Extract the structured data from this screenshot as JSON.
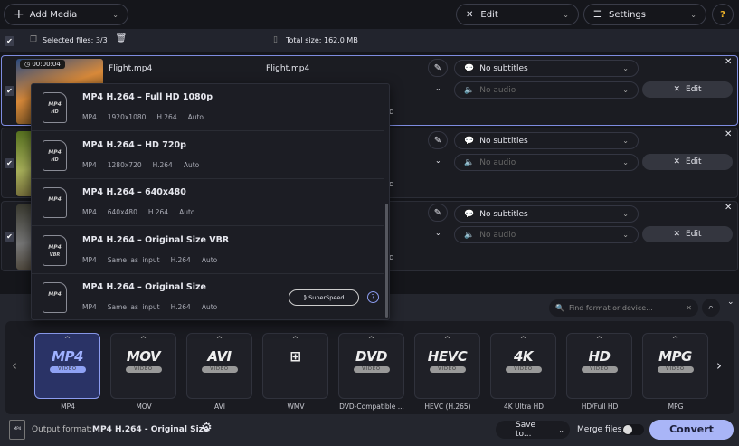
{
  "toolbar": {
    "add_media": "Add Media",
    "edit": "Edit",
    "settings": "Settings",
    "help": "?"
  },
  "selection": {
    "selected_label": "Selected files: 3/3",
    "total_size": "Total size: 162.0 MB"
  },
  "files": [
    {
      "duration": "00:00:04",
      "name": "Flight.mp4",
      "output_name": "Flight.mp4",
      "subtitles": "No subtitles",
      "audio": "No audio",
      "edit": "Edit",
      "selected": true
    },
    {
      "duration": "",
      "name": "",
      "output_name": "",
      "subtitles": "No subtitles",
      "audio": "No audio",
      "edit": "Edit",
      "selected": false
    },
    {
      "duration": "",
      "name": "",
      "output_name": "",
      "subtitles": "No subtitles",
      "audio": "No audio",
      "edit": "Edit",
      "selected": false
    }
  ],
  "row_trailing_text": "d",
  "presets": [
    {
      "icon": "MP4",
      "badge": "HD",
      "title": "MP4 H.264 – Full HD 1080p",
      "meta": [
        "MP4",
        "1920x1080",
        "H.264",
        "Auto"
      ]
    },
    {
      "icon": "MP4",
      "badge": "HD",
      "title": "MP4 H.264 – HD 720p",
      "meta": [
        "MP4",
        "1280x720",
        "H.264",
        "Auto"
      ]
    },
    {
      "icon": "MP4",
      "badge": "",
      "title": "MP4 H.264 – 640x480",
      "meta": [
        "MP4",
        "640x480",
        "H.264",
        "Auto"
      ]
    },
    {
      "icon": "MP4",
      "badge": "VBR",
      "title": "MP4 H.264 – Original Size VBR",
      "meta": [
        "MP4",
        "Same as input",
        "H.264",
        "Auto"
      ]
    },
    {
      "icon": "MP4",
      "badge": "",
      "title": "MP4 H.264 – Original Size",
      "meta": [
        "MP4",
        "Same as input",
        "H.264",
        "Auto"
      ]
    }
  ],
  "superspeed": "SuperSpeed",
  "search": {
    "placeholder": "Find format or device..."
  },
  "formats": [
    {
      "logo": "MP4",
      "label": "MP4",
      "selected": true
    },
    {
      "logo": "MOV",
      "label": "MOV"
    },
    {
      "logo": "AVI",
      "label": "AVI"
    },
    {
      "logo": "⊞",
      "label": "WMV"
    },
    {
      "logo": "DVD",
      "label": "DVD-Compatible ..."
    },
    {
      "logo": "HEVC",
      "label": "HEVC (H.265)"
    },
    {
      "logo": "4K",
      "label": "4K Ultra HD"
    },
    {
      "logo": "HD",
      "label": "HD/Full HD"
    },
    {
      "logo": "MPG",
      "label": "MPG"
    }
  ],
  "video_badge": "VIDEO",
  "footer": {
    "output_label": "Output format:",
    "output_value": "MP4 H.264 - Original Size",
    "save_to": "Save to...",
    "merge": "Merge files:",
    "merge_on": false,
    "convert": "Convert"
  },
  "colors": {
    "accent": "#a9b5f7",
    "selected_border": "#7e8ce0",
    "help": "#f0b429"
  }
}
